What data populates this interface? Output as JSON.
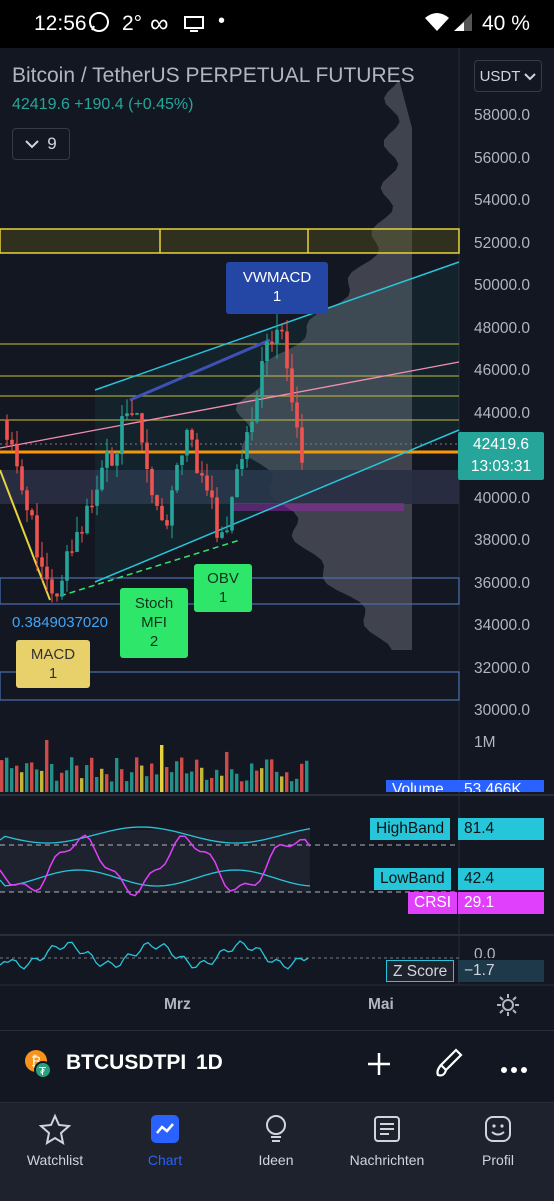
{
  "status_bar": {
    "time": "12:56",
    "temp": "2°",
    "infinity": "∞",
    "battery": "40 %"
  },
  "header": {
    "title": "Bitcoin / TetherUS PERPETUAL FUTURES",
    "price_change": "42419.6  +190.4 (+0.45%)",
    "indicator_count": "9",
    "currency": "USDT"
  },
  "price_axis": [
    "58000.0",
    "56000.0",
    "54000.0",
    "52000.0",
    "50000.0",
    "48000.0",
    "46000.0",
    "44000.0",
    "42000.0",
    "40000.0",
    "38000.0",
    "36000.0",
    "34000.0",
    "32000.0",
    "30000.0"
  ],
  "price_tag": {
    "price": "42419.6",
    "countdown": "13:03:31"
  },
  "chart_labels": {
    "vwmacd": "VWMACD\n1",
    "stoch": "Stoch\nMFI\n2",
    "obv": "OBV\n1",
    "macd": "MACD\n1",
    "fib_value": "0.3849037020"
  },
  "volume": {
    "axis": "1M",
    "label": "Volume",
    "value": "53.466K"
  },
  "crsi": {
    "high_label": "HighBand",
    "high_value": "81.4",
    "low_label": "LowBand",
    "low_value": "42.4",
    "crsi_label": "CRSI",
    "crsi_value": "29.1"
  },
  "zscore": {
    "axis": "0.0",
    "label": "Z Score",
    "value": "−1.7"
  },
  "time_axis": [
    "Mrz",
    "Mai"
  ],
  "symbol_bar": {
    "symbol": "BTCUSDTPI",
    "interval": "1D"
  },
  "nav": [
    {
      "label": "Watchlist",
      "icon": "star-icon"
    },
    {
      "label": "Chart",
      "icon": "chart-icon"
    },
    {
      "label": "Ideen",
      "icon": "lightbulb-icon"
    },
    {
      "label": "Nachrichten",
      "icon": "news-icon"
    },
    {
      "label": "Profil",
      "icon": "smiley-icon"
    }
  ],
  "colors": {
    "up": "#26a69a",
    "down": "#ef5350",
    "accent": "#2962ff",
    "bg": "#131722"
  }
}
